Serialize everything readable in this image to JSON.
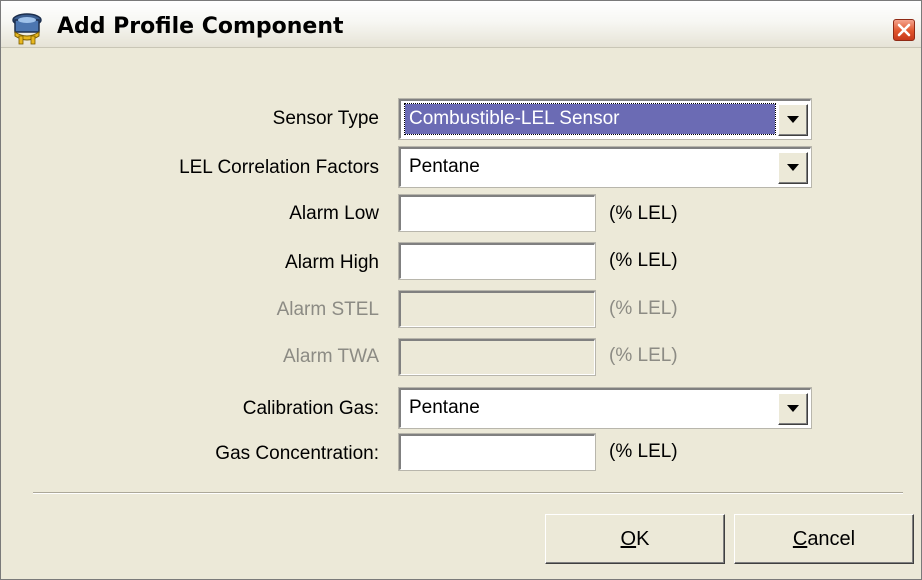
{
  "window": {
    "title": "Add Profile Component",
    "icon": "sensor-app-icon",
    "close_icon": "close-icon"
  },
  "form": {
    "sensor_type": {
      "label": "Sensor Type",
      "value": "Combustible-LEL Sensor",
      "selected": true
    },
    "lel_correlation": {
      "label": "LEL Correlation Factors",
      "value": "Pentane"
    },
    "alarm_low": {
      "label": "Alarm Low",
      "value": "",
      "unit": "(% LEL)",
      "enabled": true
    },
    "alarm_high": {
      "label": "Alarm High",
      "value": "",
      "unit": "(% LEL)",
      "enabled": true
    },
    "alarm_stel": {
      "label": "Alarm STEL",
      "value": "",
      "unit": "(% LEL)",
      "enabled": false
    },
    "alarm_twa": {
      "label": "Alarm TWA",
      "value": "",
      "unit": "(% LEL)",
      "enabled": false
    },
    "calibration_gas": {
      "label": "Calibration Gas:",
      "value": "Pentane"
    },
    "gas_concentration": {
      "label": "Gas Concentration:",
      "value": "",
      "unit": "(% LEL)",
      "enabled": true
    }
  },
  "buttons": {
    "ok": {
      "mnemonic": "O",
      "rest": "K"
    },
    "cancel": {
      "mnemonic": "C",
      "rest": "ancel"
    }
  },
  "colors": {
    "selection": "#6b6bb4",
    "dialog_bg": "#ece9d8",
    "disabled_text": "#8c8b84"
  }
}
